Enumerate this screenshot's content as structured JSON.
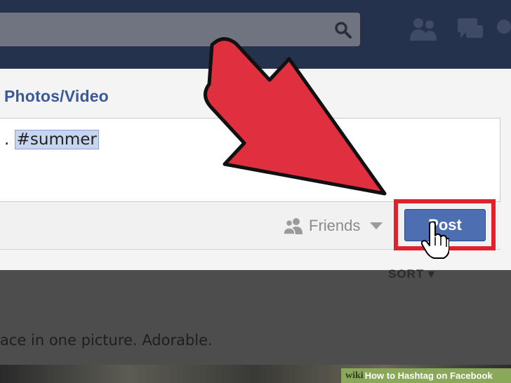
{
  "composer": {
    "tab_label": "Photos/Video",
    "text_prefix": ". ",
    "hashtag": "#summer",
    "audience_label": "Friends",
    "post_label": "Post"
  },
  "feed": {
    "sort_label": "SORT",
    "post_text": "ace in one picture. Adorable."
  },
  "watermark": {
    "brand": "wiki",
    "title": "How to Hashtag on Facebook"
  },
  "colors": {
    "topbar": "#25324d",
    "facebook_blue": "#3b5998",
    "post_button": "#4d6eb0",
    "highlight_red": "#e0202a"
  },
  "icons": [
    "search-icon",
    "friend-requests-icon",
    "messages-icon",
    "friends-audience-icon",
    "chevron-down-icon",
    "hand-cursor-icon",
    "arrow-annotation"
  ]
}
